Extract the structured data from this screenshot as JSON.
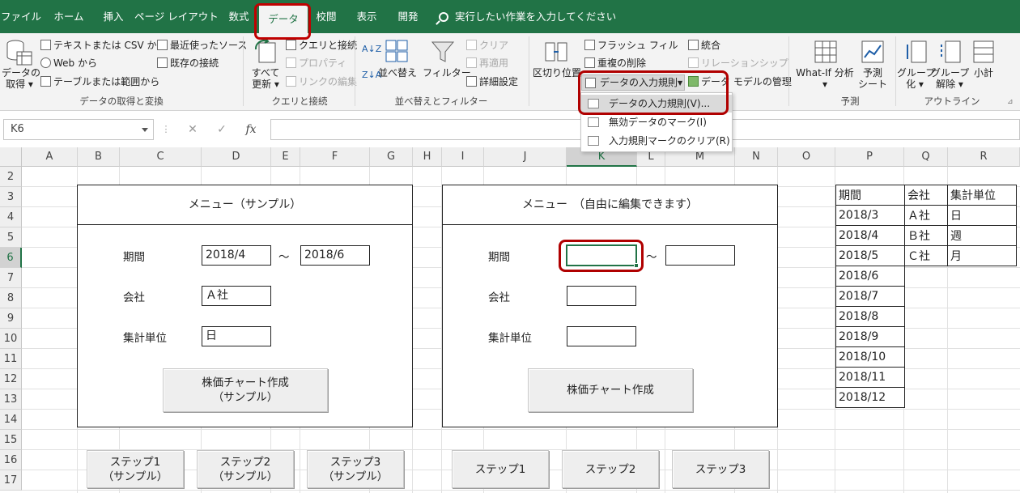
{
  "tabs": [
    "ファイル",
    "ホーム",
    "挿入",
    "ページ レイアウト",
    "数式",
    "データ",
    "校閲",
    "表示",
    "開発"
  ],
  "tell_me": "実行したい作業を入力してください",
  "ribbon": {
    "get_data": "データの\n取得 ▾",
    "from_text_csv": "テキストまたは CSV から",
    "from_web": "Web から",
    "from_table": "テーブルまたは範囲から",
    "recent_sources": "最近使ったソース",
    "existing_connections": "既存の接続",
    "group_get_transform": "データの取得と変換",
    "refresh_all": "すべて\n更新 ▾",
    "queries_connections": "クエリと接続",
    "properties": "プロパティ",
    "edit_links": "リンクの編集",
    "group_queries": "クエリと接続",
    "sort_az": "A↓Z",
    "sort_za": "Z↓A",
    "sort": "並べ替え",
    "filter": "フィルター",
    "clear": "クリア",
    "reapply": "再適用",
    "advanced": "詳細設定",
    "group_sort_filter": "並べ替えとフィルター",
    "text_to_columns": "区切り位置",
    "flash_fill": "フラッシュ フィル",
    "remove_duplicates": "重複の削除",
    "data_validation": "データの入力規則",
    "consolidate": "統合",
    "relationships": "リレーションシップ",
    "data_model": "データ モデルの管理",
    "whatif": "What-If 分析\n▾",
    "forecast_sheet": "予測\nシート",
    "group_forecast": "予測",
    "group": "グループ\n化 ▾",
    "ungroup": "グループ\n解除 ▾",
    "subtotal": "小計",
    "group_outline": "アウトライン"
  },
  "dropdown": {
    "item1": "データの入力規則(V)...",
    "item2": "無効データのマーク(I)",
    "item3": "入力規則マークのクリア(R)"
  },
  "name_box": "K6",
  "formula": "",
  "columns": [
    "A",
    "B",
    "C",
    "D",
    "E",
    "F",
    "G",
    "H",
    "I",
    "J",
    "K",
    "L",
    "M",
    "N",
    "O",
    "P",
    "Q",
    "R"
  ],
  "rows": [
    "2",
    "3",
    "4",
    "5",
    "6",
    "7",
    "8",
    "9",
    "10",
    "11",
    "12",
    "13",
    "14",
    "15",
    "16",
    "17"
  ],
  "sample": {
    "title": "メニュー（サンプル）",
    "period_label": "期間",
    "period_from": "2018/4",
    "tilde": "～",
    "period_to": "2018/6",
    "company_label": "会社",
    "company": "Ａ社",
    "unit_label": "集計単位",
    "unit": "日",
    "chart_button": "株価チャート作成\n（サンプル）"
  },
  "editable": {
    "title": "メニュー　（自由に編集できます）",
    "period_label": "期間",
    "tilde": "～",
    "company_label": "会社",
    "unit_label": "集計単位",
    "chart_button": "株価チャート作成"
  },
  "steps_sample": [
    "ステップ1\n（サンプル）",
    "ステップ2\n（サンプル）",
    "ステップ3\n（サンプル）"
  ],
  "steps": [
    "ステップ1",
    "ステップ2",
    "ステップ3"
  ],
  "lookup": {
    "headers": [
      "期間",
      "会社",
      "集計単位"
    ],
    "periods": [
      "2018/3",
      "2018/4",
      "2018/5",
      "2018/6",
      "2018/7",
      "2018/8",
      "2018/9",
      "2018/10",
      "2018/11",
      "2018/12"
    ],
    "companies": [
      "Ａ社",
      "Ｂ社",
      "Ｃ社"
    ],
    "units": [
      "日",
      "週",
      "月"
    ]
  },
  "colors": {
    "excel_green": "#217346",
    "highlight_red": "#c00000"
  }
}
